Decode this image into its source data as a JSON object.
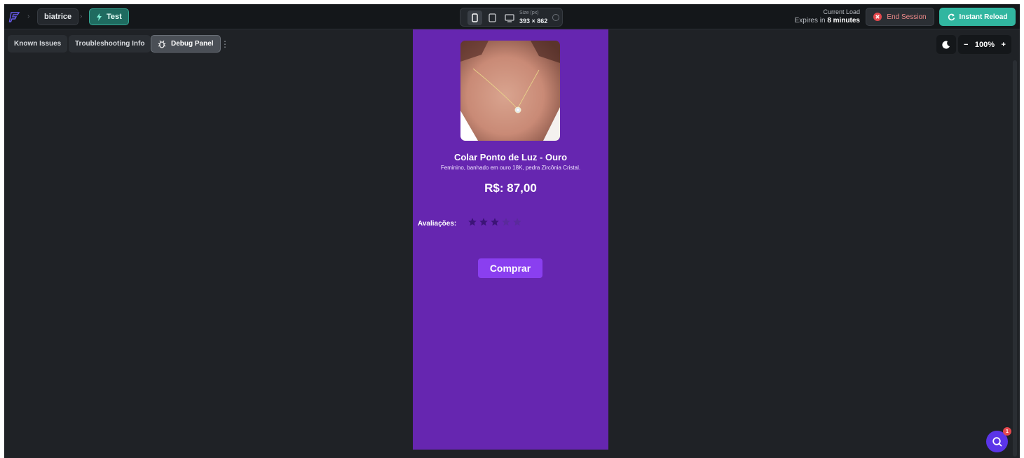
{
  "topbar": {
    "project_name": "biatrice",
    "branch_name": "Test",
    "size_label": "Size (px)",
    "size_value": "393 × 862",
    "load_label": "Current Load",
    "expires_prefix": "Expires in",
    "expires_value": "8 minutes",
    "end_session": "End Session",
    "instant_reload": "Instant Reload"
  },
  "subtabs": {
    "known_issues": "Known Issues",
    "troubleshooting": "Troubleshooting Info",
    "debug_panel": "Debug Panel"
  },
  "zoom": {
    "minus": "−",
    "value": "100%",
    "plus": "+"
  },
  "product": {
    "title": "Colar Ponto de Luz - Ouro",
    "description": "Feminino, banhado em ouro 18K, pedra Zircônia Cristal.",
    "price": "R$: 87,00",
    "rating_label": "Avaliações:",
    "rating": 3,
    "rating_max": 5,
    "buy_label": "Comprar"
  },
  "chat": {
    "badge_count": "1"
  },
  "colors": {
    "phone_bg": "#6626b0",
    "accent_teal": "#31b6a0",
    "buy_button": "#8a3ff0",
    "star_filled": "#3c1478",
    "star_empty": "#5a2a9c"
  }
}
